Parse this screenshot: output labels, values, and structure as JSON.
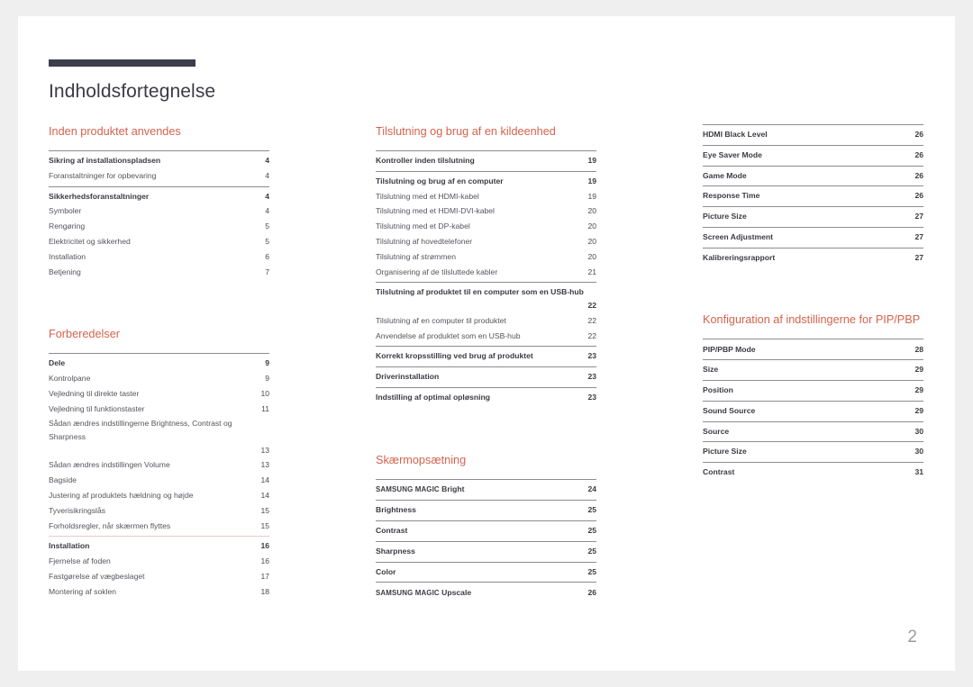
{
  "document": {
    "title": "Indholdsfortegnelse",
    "page_number": "2",
    "accent_color": "#d4634e",
    "rule_color": "#3e3d4c"
  },
  "columns": [
    {
      "sections": [
        {
          "heading": "Inden produktet anvendes",
          "groups": [
            {
              "divider": "solid",
              "entries": [
                {
                  "label": "Sikring af installationspladsen",
                  "page": "4",
                  "level": 1
                },
                {
                  "label": "Foranstaltninger for opbevaring",
                  "page": "4",
                  "level": 2
                }
              ]
            },
            {
              "divider": "solid",
              "entries": [
                {
                  "label": "Sikkerhedsforanstaltninger",
                  "page": "4",
                  "level": 1
                },
                {
                  "label": "Symboler",
                  "page": "4",
                  "level": 2
                },
                {
                  "label": "Rengøring",
                  "page": "5",
                  "level": 2
                },
                {
                  "label": "Elektricitet og sikkerhed",
                  "page": "5",
                  "level": 2
                },
                {
                  "label": "Installation",
                  "page": "6",
                  "level": 2
                },
                {
                  "label": "Betjening",
                  "page": "7",
                  "level": 2
                }
              ]
            }
          ]
        },
        {
          "heading": "Forberedelser",
          "groups": [
            {
              "divider": "solid",
              "entries": [
                {
                  "label": "Dele",
                  "page": "9",
                  "level": 1
                },
                {
                  "label": "Kontrolpane",
                  "page": "9",
                  "level": 2
                },
                {
                  "label": "Vejledning til direkte taster",
                  "page": "10",
                  "level": 2
                },
                {
                  "label": "Vejledning til funktionstaster",
                  "page": "11",
                  "level": 2
                },
                {
                  "label": "Sådan ændres indstillingerne Brightness, Contrast og Sharpness",
                  "page": "13",
                  "level": 2,
                  "wrap": true
                },
                {
                  "label": "Sådan ændres indstillingen Volume",
                  "page": "13",
                  "level": 2
                },
                {
                  "label": "Bagside",
                  "page": "14",
                  "level": 2
                },
                {
                  "label": "Justering af produktets hældning og højde",
                  "page": "14",
                  "level": 2
                },
                {
                  "label": "Tyverisikringslås",
                  "page": "15",
                  "level": 2
                },
                {
                  "label": "Forholdsregler, når skærmen flyttes",
                  "page": "15",
                  "level": 2
                }
              ]
            },
            {
              "divider": "rose",
              "entries": [
                {
                  "label": "Installation",
                  "page": "16",
                  "level": 1
                },
                {
                  "label": "Fjernelse af foden",
                  "page": "16",
                  "level": 2
                },
                {
                  "label": "Fastgørelse af vægbeslaget",
                  "page": "17",
                  "level": 2
                },
                {
                  "label": "Montering af soklen",
                  "page": "18",
                  "level": 2
                }
              ]
            }
          ]
        }
      ]
    },
    {
      "sections": [
        {
          "heading": "Tilslutning og brug af en kildeenhed",
          "groups": [
            {
              "divider": "solid",
              "entries": [
                {
                  "label": "Kontroller inden tilslutning",
                  "page": "19",
                  "level": 1
                }
              ]
            },
            {
              "divider": "solid",
              "entries": [
                {
                  "label": "Tilslutning og brug af en computer",
                  "page": "19",
                  "level": 1
                },
                {
                  "label": "Tilslutning med et HDMI-kabel",
                  "page": "19",
                  "level": 2
                },
                {
                  "label": "Tilslutning med et HDMI-DVI-kabel",
                  "page": "20",
                  "level": 2
                },
                {
                  "label": "Tilslutning med et DP-kabel",
                  "page": "20",
                  "level": 2
                },
                {
                  "label": "Tilslutning af hovedtelefoner",
                  "page": "20",
                  "level": 2
                },
                {
                  "label": "Tilslutning af strømmen",
                  "page": "20",
                  "level": 2
                },
                {
                  "label": "Organisering af de tilsluttede kabler",
                  "page": "21",
                  "level": 2
                }
              ]
            },
            {
              "divider": "solid",
              "entries": [
                {
                  "label": "Tilslutning af produktet til en computer som en USB-hub",
                  "page": "22",
                  "level": 1,
                  "wrap": true
                },
                {
                  "label": "Tilslutning af en computer til produktet",
                  "page": "22",
                  "level": 2
                },
                {
                  "label": "Anvendelse af produktet som en USB-hub",
                  "page": "22",
                  "level": 2
                }
              ]
            },
            {
              "divider": "solid",
              "entries": [
                {
                  "label": "Korrekt kropsstilling ved brug af produktet",
                  "page": "23",
                  "level": 1
                }
              ]
            },
            {
              "divider": "solid",
              "entries": [
                {
                  "label": "Driverinstallation",
                  "page": "23",
                  "level": 1
                }
              ]
            },
            {
              "divider": "solid",
              "entries": [
                {
                  "label": "Indstilling af optimal opløsning",
                  "page": "23",
                  "level": 1
                }
              ]
            }
          ]
        },
        {
          "heading": "Skærmopsætning",
          "groups": [
            {
              "divider": "solid",
              "entries": [
                {
                  "label": "SAMSUNG MAGIC Bright",
                  "page": "24",
                  "level": 1,
                  "smallcaps_prefix": "SAMSUNG MAGIC",
                  "rest": " Bright"
                }
              ]
            },
            {
              "divider": "solid",
              "entries": [
                {
                  "label": "Brightness",
                  "page": "25",
                  "level": 1
                }
              ]
            },
            {
              "divider": "solid",
              "entries": [
                {
                  "label": "Contrast",
                  "page": "25",
                  "level": 1
                }
              ]
            },
            {
              "divider": "solid",
              "entries": [
                {
                  "label": "Sharpness",
                  "page": "25",
                  "level": 1
                }
              ]
            },
            {
              "divider": "solid",
              "entries": [
                {
                  "label": "Color",
                  "page": "25",
                  "level": 1
                }
              ]
            },
            {
              "divider": "solid",
              "entries": [
                {
                  "label": "SAMSUNG MAGIC Upscale",
                  "page": "26",
                  "level": 1,
                  "smallcaps_prefix": "SAMSUNG MAGIC",
                  "rest": " Upscale"
                }
              ]
            }
          ]
        }
      ]
    },
    {
      "sections": [
        {
          "heading": "",
          "groups": [
            {
              "divider": "solid",
              "entries": [
                {
                  "label": "HDMI Black Level",
                  "page": "26",
                  "level": 1
                }
              ]
            },
            {
              "divider": "solid",
              "entries": [
                {
                  "label": "Eye Saver Mode",
                  "page": "26",
                  "level": 1
                }
              ]
            },
            {
              "divider": "solid",
              "entries": [
                {
                  "label": "Game Mode",
                  "page": "26",
                  "level": 1
                }
              ]
            },
            {
              "divider": "solid",
              "entries": [
                {
                  "label": "Response Time",
                  "page": "26",
                  "level": 1
                }
              ]
            },
            {
              "divider": "solid",
              "entries": [
                {
                  "label": "Picture Size",
                  "page": "27",
                  "level": 1
                }
              ]
            },
            {
              "divider": "solid",
              "entries": [
                {
                  "label": "Screen Adjustment",
                  "page": "27",
                  "level": 1
                }
              ]
            },
            {
              "divider": "solid",
              "entries": [
                {
                  "label": "Kalibreringsrapport",
                  "page": "27",
                  "level": 1
                }
              ]
            }
          ]
        },
        {
          "heading": "Konfiguration af indstillingerne for PIP/PBP",
          "groups": [
            {
              "divider": "solid",
              "entries": [
                {
                  "label": "PIP/PBP Mode",
                  "page": "28",
                  "level": 1
                }
              ]
            },
            {
              "divider": "solid",
              "entries": [
                {
                  "label": "Size",
                  "page": "29",
                  "level": 1
                }
              ]
            },
            {
              "divider": "solid",
              "entries": [
                {
                  "label": "Position",
                  "page": "29",
                  "level": 1
                }
              ]
            },
            {
              "divider": "solid",
              "entries": [
                {
                  "label": "Sound Source",
                  "page": "29",
                  "level": 1
                }
              ]
            },
            {
              "divider": "solid",
              "entries": [
                {
                  "label": "Source",
                  "page": "30",
                  "level": 1
                }
              ]
            },
            {
              "divider": "solid",
              "entries": [
                {
                  "label": "Picture Size",
                  "page": "30",
                  "level": 1
                }
              ]
            },
            {
              "divider": "solid",
              "entries": [
                {
                  "label": "Contrast",
                  "page": "31",
                  "level": 1
                }
              ]
            }
          ]
        }
      ]
    }
  ]
}
